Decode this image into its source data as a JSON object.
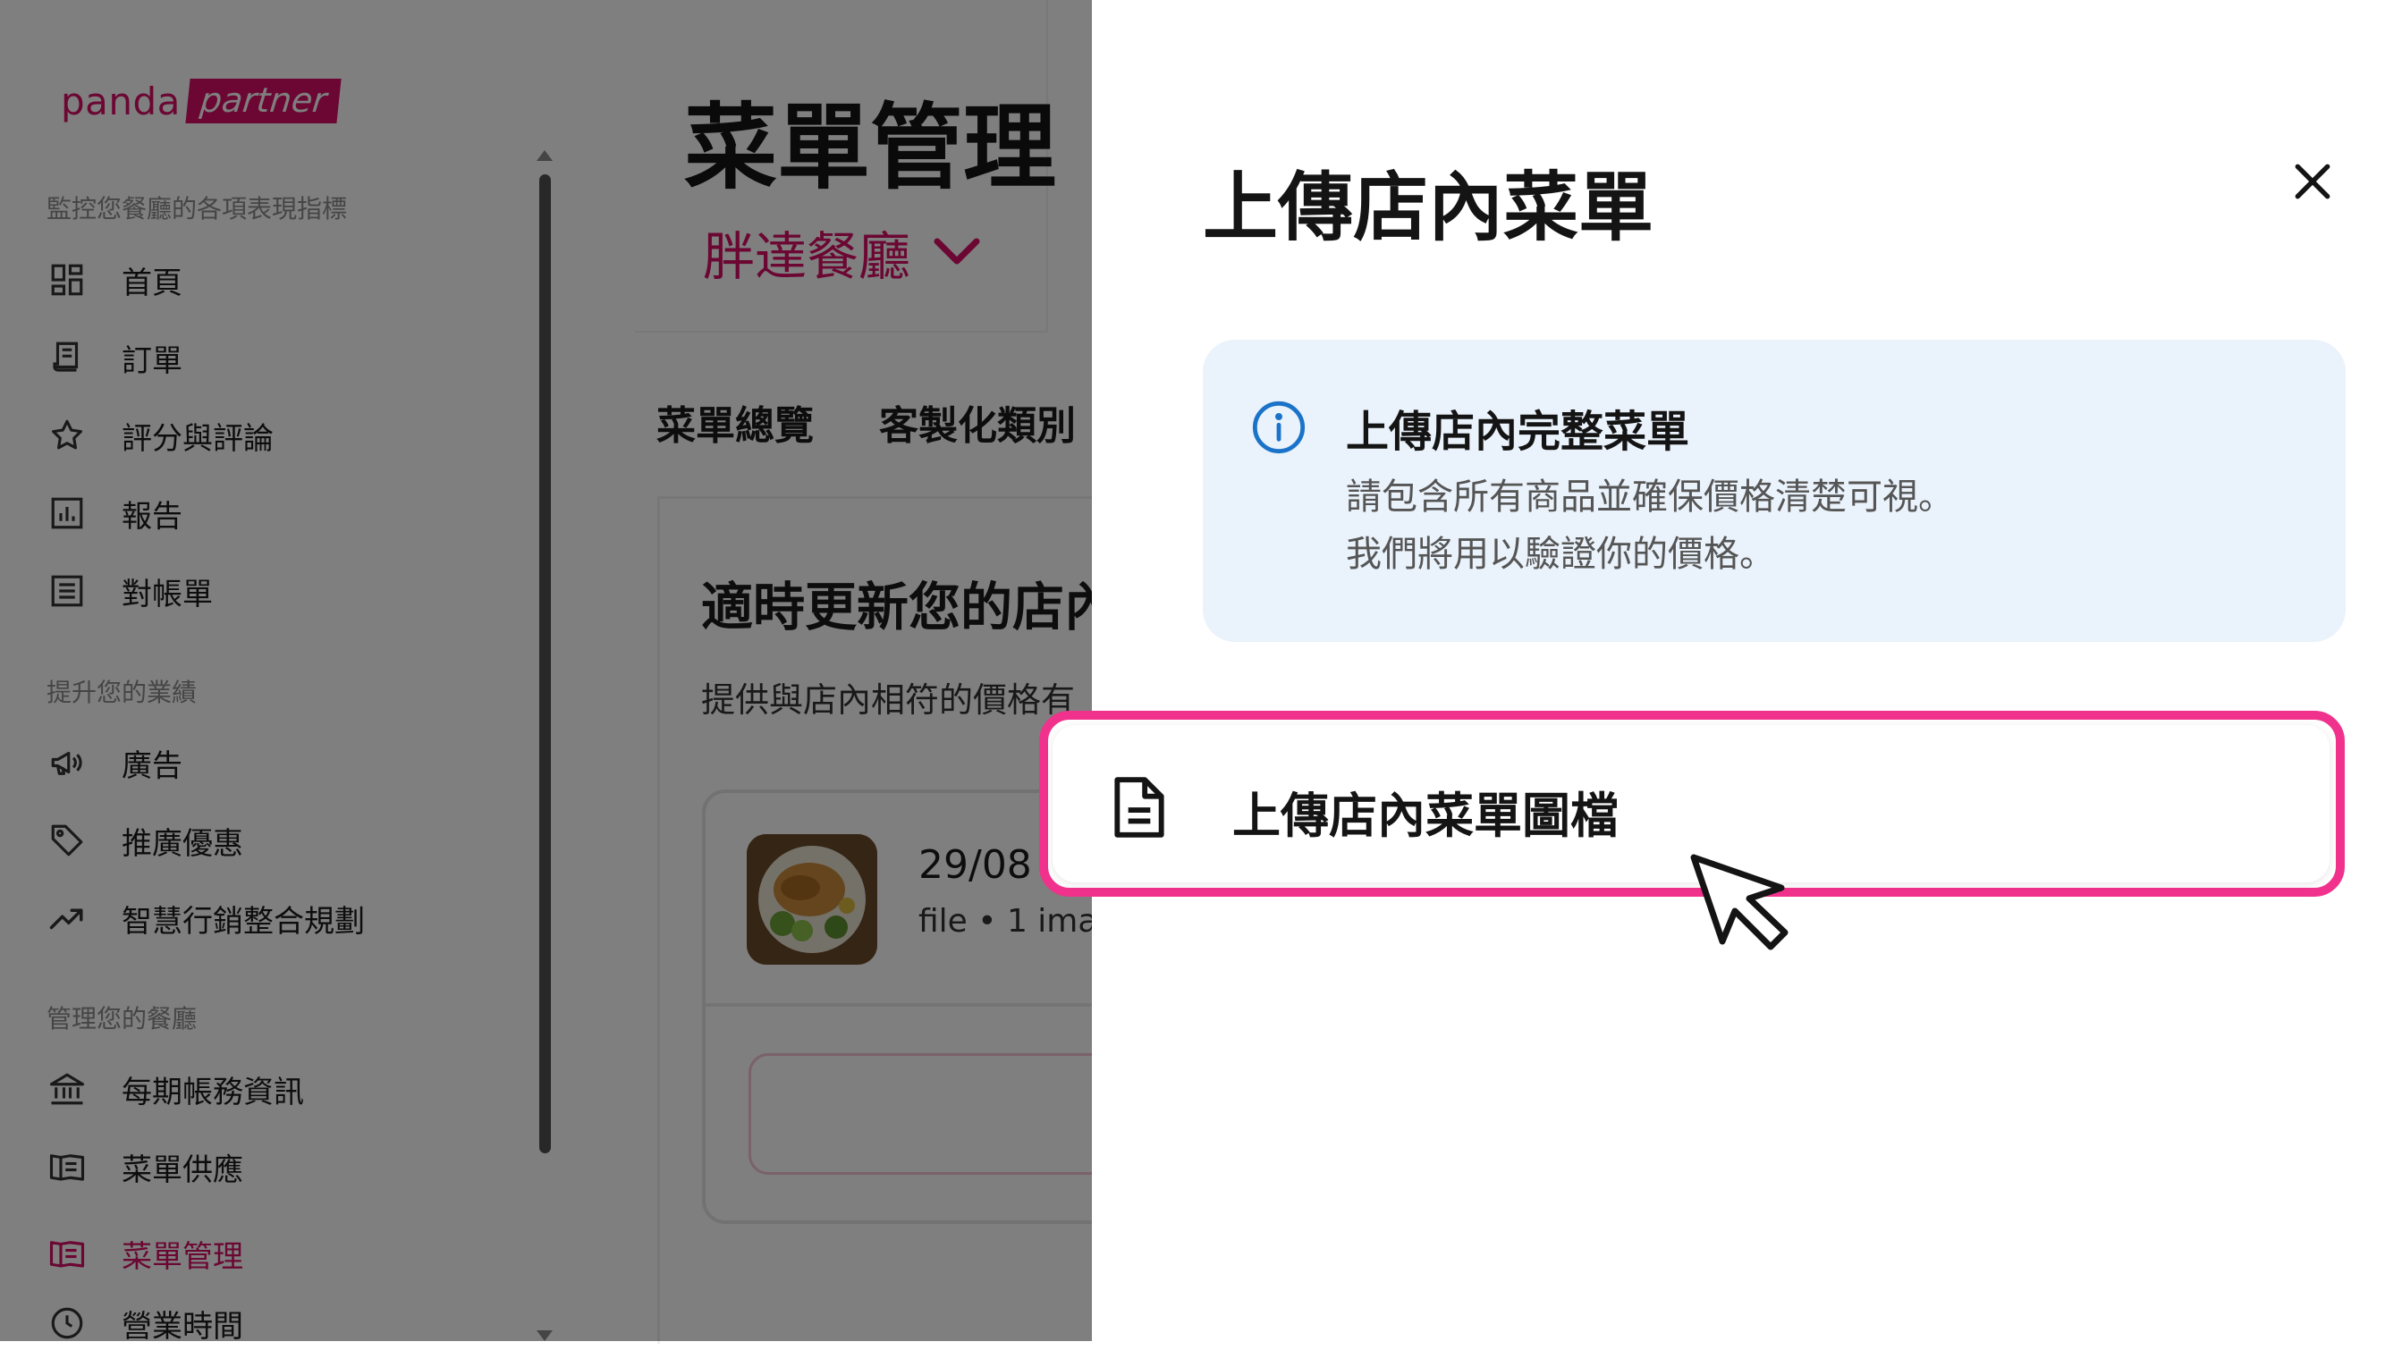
{
  "brand": {
    "logo_main": "panda",
    "logo_badge": "partner",
    "accent_color": "#d70f64"
  },
  "sidebar": {
    "section_monitor": "監控您餐廳的各項表現指標",
    "section_grow": "提升您的業績",
    "section_manage": "管理您的餐廳",
    "items": [
      {
        "label": "首頁",
        "icon": "grid-icon"
      },
      {
        "label": "訂單",
        "icon": "receipt-icon"
      },
      {
        "label": "評分與評論",
        "icon": "star-icon"
      },
      {
        "label": "報告",
        "icon": "chart-icon"
      },
      {
        "label": "對帳單",
        "icon": "list-icon"
      },
      {
        "label": "廣告",
        "icon": "megaphone-icon"
      },
      {
        "label": "推廣優惠",
        "icon": "tag-icon"
      },
      {
        "label": "智慧行銷整合規劃",
        "icon": "trend-icon"
      },
      {
        "label": "每期帳務資訊",
        "icon": "bank-icon"
      },
      {
        "label": "菜單供應",
        "icon": "menu-book-icon"
      },
      {
        "label": "菜單管理",
        "icon": "menu-book-icon",
        "active": true
      },
      {
        "label": "營業時間",
        "icon": "clock-icon"
      }
    ]
  },
  "page": {
    "title": "菜單管理",
    "restaurant": "胖達餐廳",
    "tabs": [
      "菜單總覽",
      "客製化類別"
    ],
    "card_title": "適時更新您的店內",
    "card_sub": "提供與店內相符的價格有",
    "file_date": "29/08",
    "file_meta": "file • 1 ima"
  },
  "modal": {
    "title": "上傳店內菜單",
    "info_title": "上傳店內完整菜單",
    "info_line1": "請包含所有商品並確保價格清楚可視。",
    "info_line2": "我們將用以驗證你的價格。",
    "upload_option": "上傳店內菜單圖檔",
    "highlight_color": "#f0328c"
  }
}
